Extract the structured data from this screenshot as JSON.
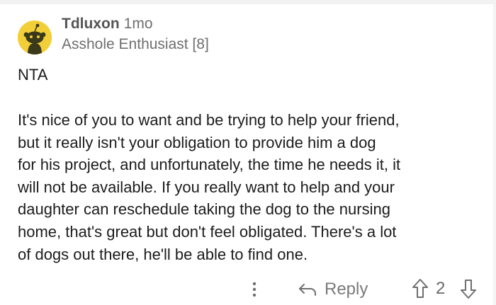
{
  "comment": {
    "author": "Tdluxon",
    "age": "1mo",
    "flair": "Asshole Enthusiast [8]",
    "verdict": "NTA",
    "body_lines": [
      "It's nice of you to want and be trying to help your friend,",
      "but it really isn't your obligation to provide him a dog",
      "for his project, and unfortunately, the time he needs it, it",
      "will not be available.  If you really want to help and your",
      "daughter can reschedule taking the dog to the nursing",
      "home, that's great but don't feel obligated.  There's a lot",
      "of dogs out there, he'll be able to find one."
    ],
    "actions": {
      "more_icon": "vertical-ellipsis-icon",
      "reply_icon": "reply-arrow-icon",
      "reply_label": "Reply",
      "upvote_icon": "arrow-up-outline-icon",
      "score": "2",
      "downvote_icon": "arrow-down-outline-icon"
    }
  },
  "colors": {
    "avatar_background": "#f2cf39",
    "text": "#1c1c1c",
    "muted": "#6f6f6f"
  }
}
